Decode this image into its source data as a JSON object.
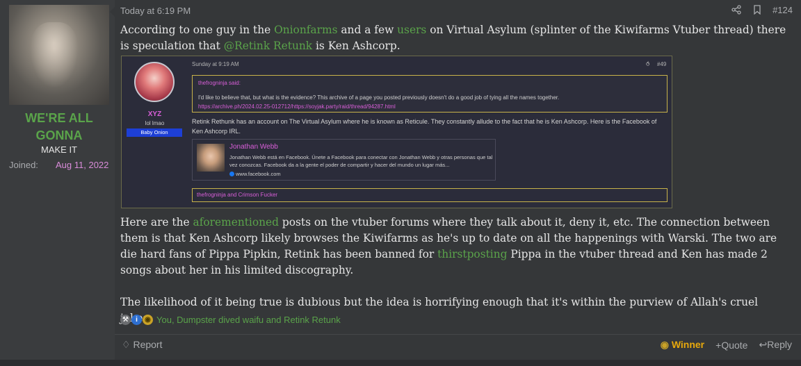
{
  "user": {
    "name_line1": "WE'RE ALL",
    "name_line2": "GONNA",
    "title": "MAKE IT",
    "joined_label": "Joined:",
    "joined_value": "Aug 11, 2022"
  },
  "header": {
    "date": "Today at 6:19 PM",
    "post_number": "#124",
    "icons": [
      "share-icon",
      "bookmark-icon"
    ]
  },
  "body": {
    "p1_a": "According to one guy in the ",
    "p1_link1": "Onionfarms",
    "p1_b": " and a few ",
    "p1_link2": "users",
    "p1_c": " on Virtual Asylum (splinter of the Kiwifarms Vtuber thread) there is speculation that ",
    "p1_link3": "@Retink Retunk",
    "p1_d": " is Ken Ashcorp.",
    "p2_a": "Here are the ",
    "p2_link1": "aforementioned",
    "p2_b": " posts on the vtuber forums where they talk about it, deny it, etc. The connection between them is that Ken Ashcorp likely browses the Kiwifarms as he's up to date on all the happenings with Warski. The two are die hard fans of Pippa Pipkin, Retink has been banned for ",
    "p2_link2": "thirstposting",
    "p2_c": " Pippa in the vtuber thread and Ken has made 2 songs about her in his limited discography.",
    "p3": "The likelihood of it being true is dubious but the idea is horrifying enough that it's within the purview of Allah's cruel jokes."
  },
  "embed": {
    "user_name": "XYZ",
    "user_sub": "lol lmao",
    "user_badge": "Baby Onion",
    "date": "Sunday at 9:19 AM",
    "post_number": "#49",
    "quote_author": "thefrogninja said:",
    "quote_text": "I'd like to believe that, but what is the evidence? This archive of a page you posted previously doesn't do a good job of tying all the names together.",
    "quote_link": "https://archive.ph/2024.02.25-012712/https://soyjak.party/raid/thread/94287.html",
    "body_text": "Retink Rethunk has an account on The Virtual Asylum where he is known as Reticule. They constantly allude to the fact that he is Ken Ashcorp. Here is the Facebook of Ken Ashcorp IRL.",
    "card_title": "Jonathan Webb",
    "card_desc": "Jonathan Webb está en Facebook. Únete a Facebook para conectar con Jonathan Webb y otras personas que tal vez conozcas. Facebook da a la gente el poder de compartir y hacer del mundo un lugar más...",
    "card_site": "www.facebook.com",
    "reactions_text": "thefrogninja and Crimson Fucker"
  },
  "reactions": {
    "text": "You, Dumpster dived waifu and Retink Retunk"
  },
  "footer": {
    "report": "Report",
    "winner": "Winner",
    "quote": "Quote",
    "reply": "Reply"
  }
}
